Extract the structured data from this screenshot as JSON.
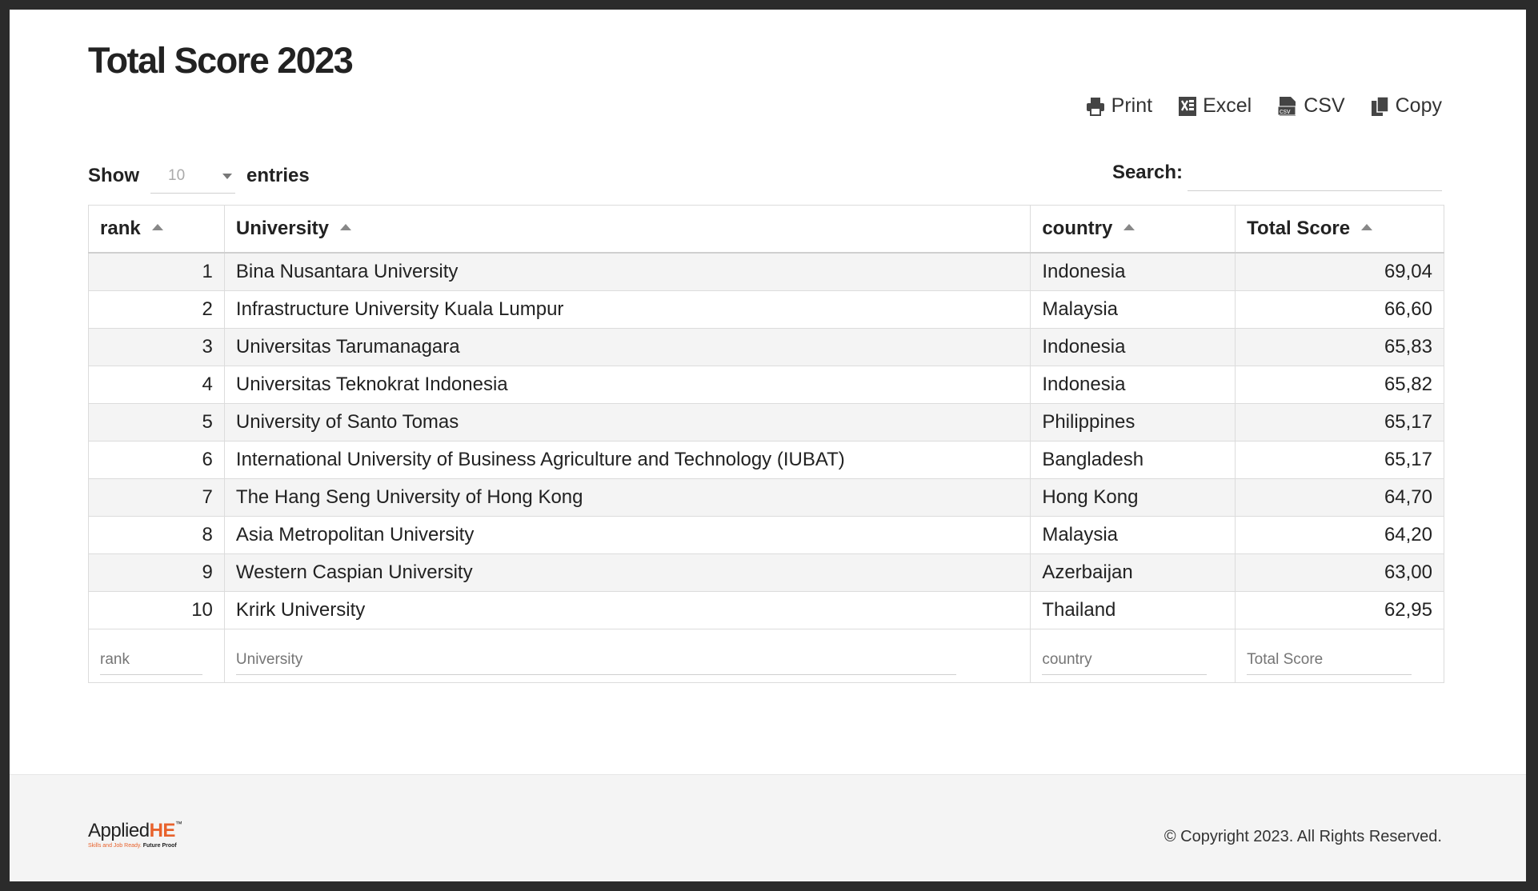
{
  "page": {
    "title": "Total Score 2023"
  },
  "toolbar": {
    "print_label": "Print",
    "excel_label": "Excel",
    "csv_label": "CSV",
    "copy_label": "Copy"
  },
  "length": {
    "show_label": "Show",
    "value": "10",
    "entries_label": "entries"
  },
  "search": {
    "label": "Search:",
    "value": ""
  },
  "table": {
    "headers": [
      "rank",
      "University",
      "country",
      "Total Score"
    ],
    "rows": [
      [
        "1",
        "Bina Nusantara University",
        "Indonesia",
        "69,04"
      ],
      [
        "2",
        "Infrastructure University Kuala Lumpur",
        "Malaysia",
        "66,60"
      ],
      [
        "3",
        "Universitas Tarumanagara",
        "Indonesia",
        "65,83"
      ],
      [
        "4",
        "Universitas Teknokrat Indonesia",
        "Indonesia",
        "65,82"
      ],
      [
        "5",
        "University of Santo Tomas",
        "Philippines",
        "65,17"
      ],
      [
        "6",
        "International University of Business Agriculture and Technology (IUBAT)",
        "Bangladesh",
        "65,17"
      ],
      [
        "7",
        "The Hang Seng University of Hong Kong",
        "Hong Kong",
        "64,70"
      ],
      [
        "8",
        "Asia Metropolitan University",
        "Malaysia",
        "64,20"
      ],
      [
        "9",
        "Western Caspian University",
        "Azerbaijan",
        "63,00"
      ],
      [
        "10",
        "Krirk University",
        "Thailand",
        "62,95"
      ]
    ],
    "filter_placeholders": [
      "rank",
      "University",
      "country",
      "Total Score"
    ]
  },
  "footer": {
    "logo_text": "Applied",
    "logo_accent": "HE",
    "logo_tm": "™",
    "logo_tagline_a": "Skills and Job Ready.",
    "logo_tagline_b": "Future Proof",
    "copyright": "© Copyright 2023. All Rights Reserved."
  },
  "colors": {
    "accent": "#e8622c",
    "stripe": "#f4f4f4",
    "border": "#dcdcdc"
  }
}
